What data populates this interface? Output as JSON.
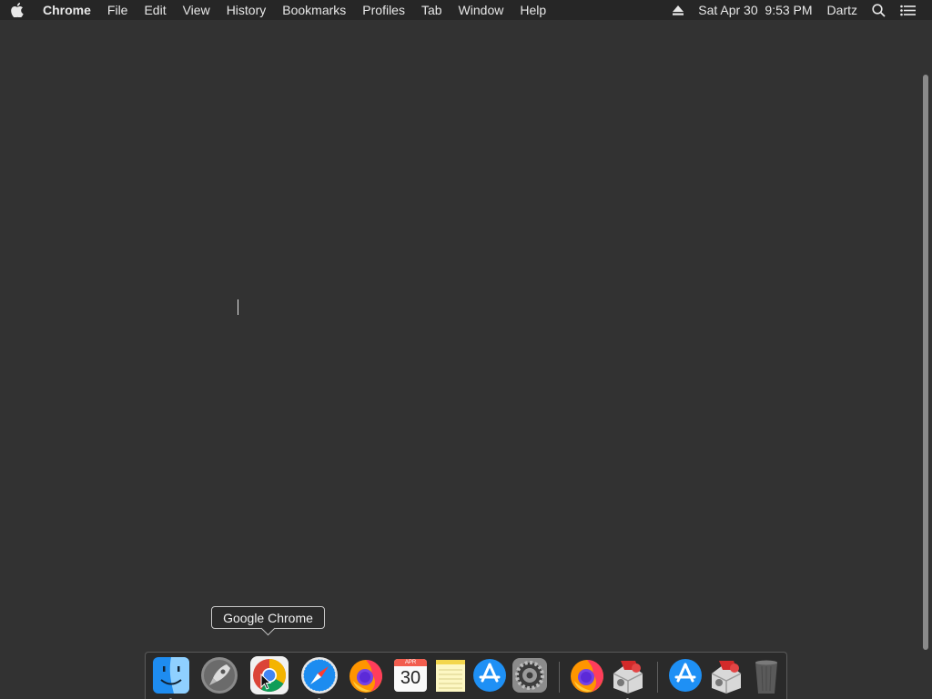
{
  "menubar": {
    "apple_icon": "apple-logo-icon",
    "app_name": "Chrome",
    "items": [
      "File",
      "Edit",
      "View",
      "History",
      "Bookmarks",
      "Profiles",
      "Tab",
      "Window",
      "Help"
    ],
    "eject_icon": "eject-icon",
    "datetime": "Sat Apr 30  9:53 PM",
    "user": "Dartz",
    "search_icon": "spotlight-search-icon",
    "control_icon": "notification-center-icon"
  },
  "tooltip": {
    "text": "Google Chrome"
  },
  "dock": {
    "apps": [
      {
        "name": "Finder",
        "icon": "finder-icon",
        "running": true
      },
      {
        "name": "Launchpad",
        "icon": "launchpad-rocket-icon",
        "running": false
      },
      {
        "name": "Google Chrome",
        "icon": "chrome-icon",
        "running": true
      },
      {
        "name": "Safari",
        "icon": "safari-compass-icon",
        "running": true
      },
      {
        "name": "Firefox",
        "icon": "firefox-icon",
        "running": true
      },
      {
        "name": "Calendar",
        "icon": "calendar-icon",
        "running": false,
        "month": "APR",
        "day": "30"
      },
      {
        "name": "Notes",
        "icon": "notes-icon",
        "running": false
      },
      {
        "name": "App Store",
        "icon": "app-store-icon",
        "running": false
      },
      {
        "name": "System Preferences",
        "icon": "system-preferences-gear-icon",
        "running": false
      },
      {
        "name": "Firefox",
        "icon": "firefox-icon",
        "running": false
      },
      {
        "name": "Installer",
        "icon": "installer-icon",
        "running": true
      },
      {
        "name": "App Store",
        "icon": "app-store-icon",
        "running": false
      },
      {
        "name": "Installer",
        "icon": "installer-icon",
        "running": false
      },
      {
        "name": "Trash",
        "icon": "trash-icon",
        "running": false
      }
    ]
  },
  "colors": {
    "desktop": "#323232",
    "menubar": "#262626",
    "chrome_red": "#db4437",
    "chrome_yellow": "#f4b400",
    "chrome_green": "#0f9d58",
    "chrome_blue": "#4285f4"
  }
}
